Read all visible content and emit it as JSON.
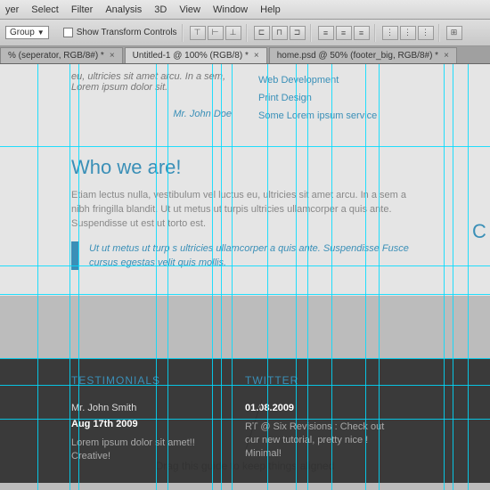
{
  "menu": {
    "items": [
      "yer",
      "Select",
      "Filter",
      "Analysis",
      "3D",
      "View",
      "Window",
      "Help"
    ]
  },
  "options": {
    "group": "Group",
    "show_transform": "Show Transform Controls"
  },
  "tabs": [
    {
      "label": "% (seperator, RGB/8#) *"
    },
    {
      "label": "Untitled-1 @ 100% (RGB/8) *"
    },
    {
      "label": "home.psd @ 50% (footer_big, RGB/8#) *"
    }
  ],
  "page": {
    "top_left": "eu, ultricies sit amet arcu. In a sem, Lorem ipsum dolor sit.",
    "author": "Mr. John Doe",
    "services": [
      "Web Development",
      "Print Design",
      "Some Lorem ipsum service"
    ],
    "who_title": "Who we are!",
    "who_body": "Etiam lectus nulla, vestibulum vel luctus eu, ultricies sit amet arcu. In a sem a nibh fringilla blandit. Ut ut metus ut turpis ultricies ullamcorper a quis ante. Suspendisse ut est ut torto est.",
    "quote": "Ut ut metus ut turp s ultricies ullamcorper a quis ante. Suspendisse Fusce cursus egestas velit quis mollis.",
    "side": "C"
  },
  "footer": {
    "col1": {
      "title": "TESTIMONIALS",
      "name": "Mr. John Smith",
      "date": "Aug 17th 2009",
      "body": "Lorem ipsum dolor sit amet!! Creative!"
    },
    "col2": {
      "title": "TWITTER",
      "date": "01.08.2009",
      "body": "RT @ Six Revisions : Check out our new tutorial, pretty nice ! Minimal!"
    }
  },
  "annotation": "Drag this guide to keep things aligned"
}
